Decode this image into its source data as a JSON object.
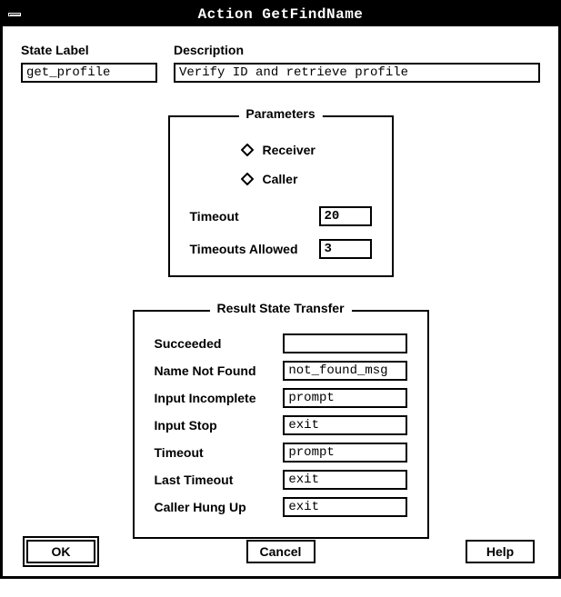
{
  "window": {
    "title": "Action GetFindName"
  },
  "top": {
    "state_label_caption": "State Label",
    "state_label_value": "get_profile",
    "description_caption": "Description",
    "description_value": "Verify ID and retrieve profile"
  },
  "parameters": {
    "legend": "Parameters",
    "radios": [
      {
        "label": "Receiver",
        "selected": false
      },
      {
        "label": "Caller",
        "selected": false
      }
    ],
    "timeout_label": "Timeout",
    "timeout_value": "20",
    "timeouts_allowed_label": "Timeouts Allowed",
    "timeouts_allowed_value": "3"
  },
  "result": {
    "legend": "Result State Transfer",
    "rows": [
      {
        "label": "Succeeded",
        "value": ""
      },
      {
        "label": "Name Not Found",
        "value": "not_found_msg"
      },
      {
        "label": "Input Incomplete",
        "value": "prompt"
      },
      {
        "label": "Input Stop",
        "value": "exit"
      },
      {
        "label": "Timeout",
        "value": "prompt"
      },
      {
        "label": "Last Timeout",
        "value": "exit"
      },
      {
        "label": "Caller Hung Up",
        "value": "exit"
      }
    ]
  },
  "buttons": {
    "ok": "OK",
    "cancel": "Cancel",
    "help": "Help"
  }
}
